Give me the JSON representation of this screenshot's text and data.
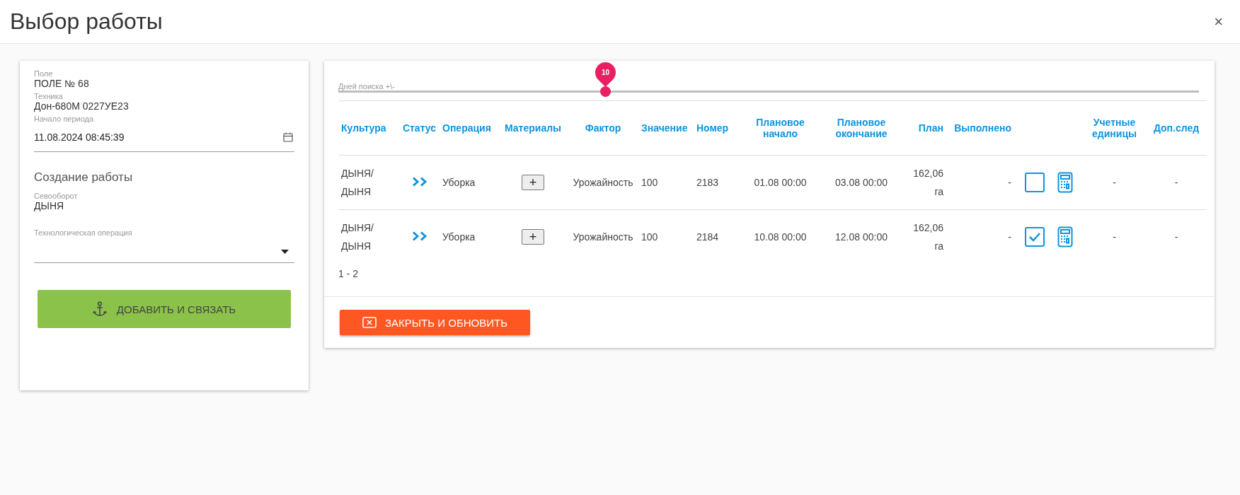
{
  "dialog": {
    "title": "Выбор работы",
    "close_label": "×"
  },
  "left_panel": {
    "fields": [
      {
        "label": "Поле",
        "value": "ПОЛЕ № 68"
      },
      {
        "label": "Техника",
        "value": "Дон-680М 0227УЕ23"
      }
    ],
    "period": {
      "label": "Начало периода",
      "value": "11.08.2024 08:45:39"
    },
    "section_title": "Создание работы",
    "rotation": {
      "label": "Севооборот",
      "value": "ДЫНЯ"
    },
    "operation": {
      "label": "Технологическая операция"
    },
    "add_button": "ДОБАВИТЬ И СВЯЗАТЬ"
  },
  "right_panel": {
    "slider": {
      "label": "Дней поиска +\\-",
      "value": "10",
      "level": 0.31
    },
    "table": {
      "columns": [
        "Культура",
        "Статус",
        "Операция",
        "Материалы",
        "Фактор",
        "Значение",
        "Номер",
        "Плановое начало",
        "Плановое окончание",
        "План",
        "Выполнено",
        "Учетные единицы",
        "Доп.след"
      ],
      "rows": [
        {
          "culture": "ДЫНЯ/ ДЫНЯ",
          "operation": "Уборка",
          "materials": "+",
          "factor": "Урожайность",
          "value": "100",
          "number": "2183",
          "plan_start": "01.08 00:00",
          "plan_end": "03.08 00:00",
          "plan": "162,06 га",
          "done": "-",
          "checked": false,
          "units": "-",
          "extra": "-"
        },
        {
          "culture": "ДЫНЯ/ ДЫНЯ",
          "operation": "Уборка",
          "materials": "+",
          "factor": "Урожайность",
          "value": "100",
          "number": "2184",
          "plan_start": "10.08 00:00",
          "plan_end": "12.08 00:00",
          "plan": "162,06 га",
          "done": "-",
          "checked": true,
          "units": "-",
          "extra": "-"
        }
      ],
      "pagination": "1 - 2"
    },
    "close_button": "ЗАКРЫТЬ И ОБНОВИТЬ"
  }
}
